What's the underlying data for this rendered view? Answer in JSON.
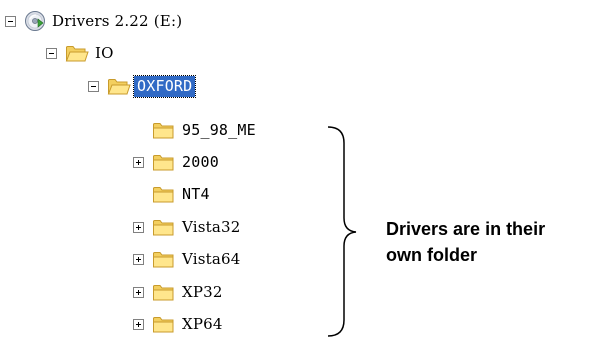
{
  "tree": {
    "drive": {
      "label": "Drivers 2.22 (E:)",
      "icon": "cd-drive-icon",
      "expanded": true
    },
    "io": {
      "label": "IO",
      "icon": "open-folder-icon",
      "expanded": true
    },
    "oxford": {
      "label": "OXFORD",
      "icon": "open-folder-icon",
      "expanded": true,
      "selected": true
    },
    "children": [
      {
        "label": "95_98_ME",
        "icon": "folder-icon",
        "has_children": false
      },
      {
        "label": "2000",
        "icon": "folder-icon",
        "has_children": true
      },
      {
        "label": "NT4",
        "icon": "folder-icon",
        "has_children": false
      },
      {
        "label": "Vista32",
        "icon": "folder-icon",
        "has_children": true
      },
      {
        "label": "Vista64",
        "icon": "folder-icon",
        "has_children": true
      },
      {
        "label": "XP32",
        "icon": "folder-icon",
        "has_children": true
      },
      {
        "label": "XP64",
        "icon": "folder-icon",
        "has_children": true
      }
    ]
  },
  "callout": {
    "line1": "Drivers are in their",
    "line2": "own folder"
  },
  "colors": {
    "selection": "#316ac5",
    "folder_fill": "#ffe68c",
    "folder_stroke": "#c89b2c"
  }
}
